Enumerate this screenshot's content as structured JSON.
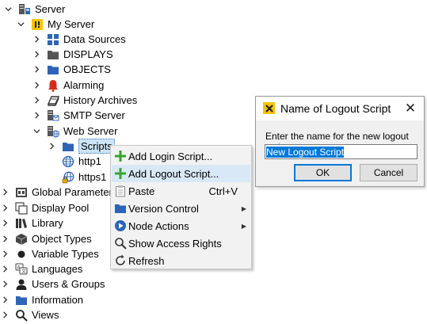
{
  "tree": {
    "server": "Server",
    "my_server": "My Server",
    "data_sources": "Data Sources",
    "displays": "DISPLAYS",
    "objects": "OBJECTS",
    "alarming": "Alarming",
    "history_archives": "History Archives",
    "smtp_server": "SMTP Server",
    "web_server": "Web Server",
    "scripts": "Scripts",
    "http1": "http1",
    "https1": "https1",
    "global_parameters": "Global Parameters",
    "display_pool": "Display Pool",
    "library": "Library",
    "object_types": "Object Types",
    "variable_types": "Variable Types",
    "languages": "Languages",
    "users_groups": "Users & Groups",
    "information": "Information",
    "views": "Views"
  },
  "context_menu": {
    "add_login_script": "Add Login Script...",
    "add_logout_script": "Add Logout Script...",
    "paste": "Paste",
    "paste_shortcut": "Ctrl+V",
    "version_control": "Version Control",
    "node_actions": "Node Actions",
    "show_access_rights": "Show Access Rights",
    "refresh": "Refresh"
  },
  "dialog": {
    "title": "Name of Logout Script",
    "close": "✕",
    "prompt": "Enter the name for the new logout script",
    "input_value": "New Logout Script",
    "ok": "OK",
    "cancel": "Cancel"
  },
  "colors": {
    "folder_blue": "#2e64b5",
    "selection_bg": "#cce4f7",
    "menu_hover": "#d9e8f7",
    "dialog_icon": "#f5c400",
    "add_green": "#3aa335",
    "alarm_red": "#d92a1c"
  }
}
